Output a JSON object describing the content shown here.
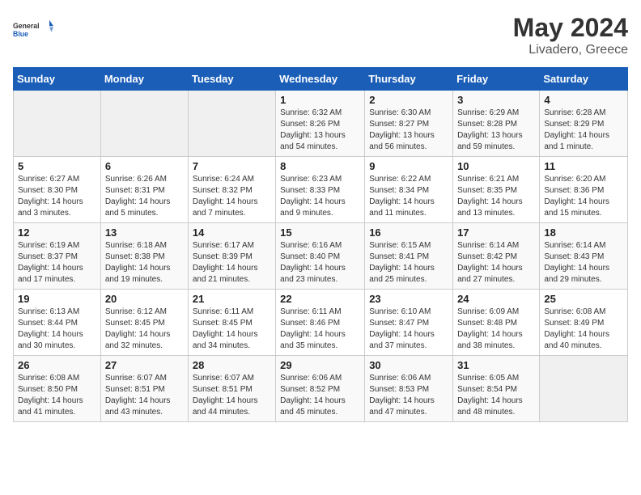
{
  "header": {
    "logo_general": "General",
    "logo_blue": "Blue",
    "title": "May 2024",
    "location": "Livadero, Greece"
  },
  "weekdays": [
    "Sunday",
    "Monday",
    "Tuesday",
    "Wednesday",
    "Thursday",
    "Friday",
    "Saturday"
  ],
  "weeks": [
    [
      {
        "day": "",
        "empty": true
      },
      {
        "day": "",
        "empty": true
      },
      {
        "day": "",
        "empty": true
      },
      {
        "day": "1",
        "sunrise": "6:32 AM",
        "sunset": "8:26 PM",
        "daylight": "13 hours and 54 minutes."
      },
      {
        "day": "2",
        "sunrise": "6:30 AM",
        "sunset": "8:27 PM",
        "daylight": "13 hours and 56 minutes."
      },
      {
        "day": "3",
        "sunrise": "6:29 AM",
        "sunset": "8:28 PM",
        "daylight": "13 hours and 59 minutes."
      },
      {
        "day": "4",
        "sunrise": "6:28 AM",
        "sunset": "8:29 PM",
        "daylight": "14 hours and 1 minute."
      }
    ],
    [
      {
        "day": "5",
        "sunrise": "6:27 AM",
        "sunset": "8:30 PM",
        "daylight": "14 hours and 3 minutes."
      },
      {
        "day": "6",
        "sunrise": "6:26 AM",
        "sunset": "8:31 PM",
        "daylight": "14 hours and 5 minutes."
      },
      {
        "day": "7",
        "sunrise": "6:24 AM",
        "sunset": "8:32 PM",
        "daylight": "14 hours and 7 minutes."
      },
      {
        "day": "8",
        "sunrise": "6:23 AM",
        "sunset": "8:33 PM",
        "daylight": "14 hours and 9 minutes."
      },
      {
        "day": "9",
        "sunrise": "6:22 AM",
        "sunset": "8:34 PM",
        "daylight": "14 hours and 11 minutes."
      },
      {
        "day": "10",
        "sunrise": "6:21 AM",
        "sunset": "8:35 PM",
        "daylight": "14 hours and 13 minutes."
      },
      {
        "day": "11",
        "sunrise": "6:20 AM",
        "sunset": "8:36 PM",
        "daylight": "14 hours and 15 minutes."
      }
    ],
    [
      {
        "day": "12",
        "sunrise": "6:19 AM",
        "sunset": "8:37 PM",
        "daylight": "14 hours and 17 minutes."
      },
      {
        "day": "13",
        "sunrise": "6:18 AM",
        "sunset": "8:38 PM",
        "daylight": "14 hours and 19 minutes."
      },
      {
        "day": "14",
        "sunrise": "6:17 AM",
        "sunset": "8:39 PM",
        "daylight": "14 hours and 21 minutes."
      },
      {
        "day": "15",
        "sunrise": "6:16 AM",
        "sunset": "8:40 PM",
        "daylight": "14 hours and 23 minutes."
      },
      {
        "day": "16",
        "sunrise": "6:15 AM",
        "sunset": "8:41 PM",
        "daylight": "14 hours and 25 minutes."
      },
      {
        "day": "17",
        "sunrise": "6:14 AM",
        "sunset": "8:42 PM",
        "daylight": "14 hours and 27 minutes."
      },
      {
        "day": "18",
        "sunrise": "6:14 AM",
        "sunset": "8:43 PM",
        "daylight": "14 hours and 29 minutes."
      }
    ],
    [
      {
        "day": "19",
        "sunrise": "6:13 AM",
        "sunset": "8:44 PM",
        "daylight": "14 hours and 30 minutes."
      },
      {
        "day": "20",
        "sunrise": "6:12 AM",
        "sunset": "8:45 PM",
        "daylight": "14 hours and 32 minutes."
      },
      {
        "day": "21",
        "sunrise": "6:11 AM",
        "sunset": "8:45 PM",
        "daylight": "14 hours and 34 minutes."
      },
      {
        "day": "22",
        "sunrise": "6:11 AM",
        "sunset": "8:46 PM",
        "daylight": "14 hours and 35 minutes."
      },
      {
        "day": "23",
        "sunrise": "6:10 AM",
        "sunset": "8:47 PM",
        "daylight": "14 hours and 37 minutes."
      },
      {
        "day": "24",
        "sunrise": "6:09 AM",
        "sunset": "8:48 PM",
        "daylight": "14 hours and 38 minutes."
      },
      {
        "day": "25",
        "sunrise": "6:08 AM",
        "sunset": "8:49 PM",
        "daylight": "14 hours and 40 minutes."
      }
    ],
    [
      {
        "day": "26",
        "sunrise": "6:08 AM",
        "sunset": "8:50 PM",
        "daylight": "14 hours and 41 minutes."
      },
      {
        "day": "27",
        "sunrise": "6:07 AM",
        "sunset": "8:51 PM",
        "daylight": "14 hours and 43 minutes."
      },
      {
        "day": "28",
        "sunrise": "6:07 AM",
        "sunset": "8:51 PM",
        "daylight": "14 hours and 44 minutes."
      },
      {
        "day": "29",
        "sunrise": "6:06 AM",
        "sunset": "8:52 PM",
        "daylight": "14 hours and 45 minutes."
      },
      {
        "day": "30",
        "sunrise": "6:06 AM",
        "sunset": "8:53 PM",
        "daylight": "14 hours and 47 minutes."
      },
      {
        "day": "31",
        "sunrise": "6:05 AM",
        "sunset": "8:54 PM",
        "daylight": "14 hours and 48 minutes."
      },
      {
        "day": "",
        "empty": true
      }
    ]
  ]
}
